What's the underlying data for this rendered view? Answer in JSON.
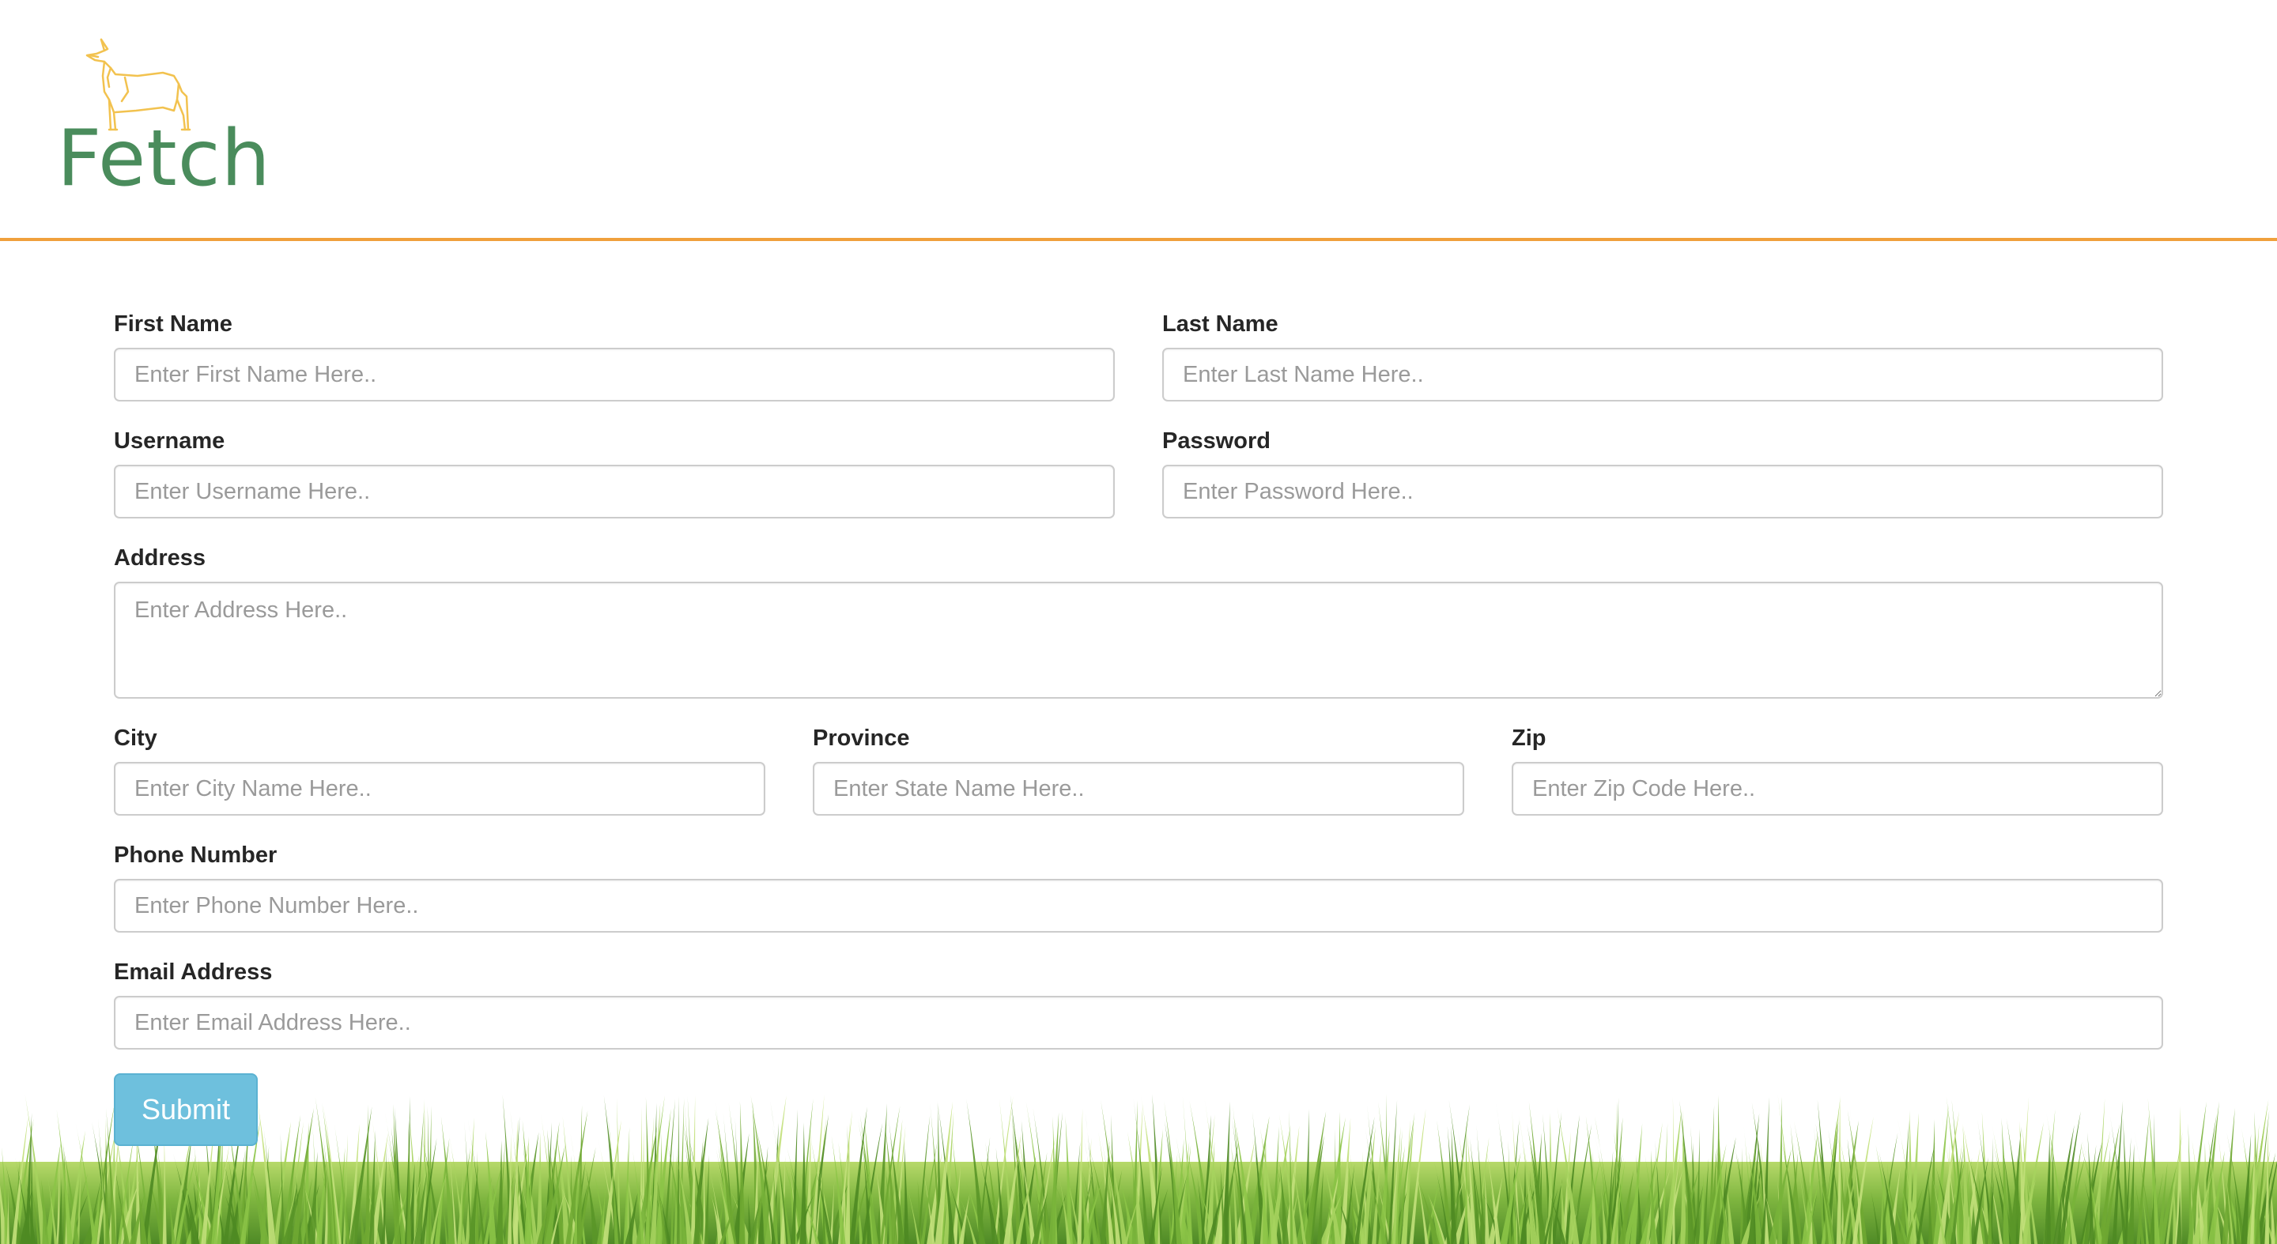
{
  "brand": {
    "name": "Fetch",
    "logo_icon": "dog-icon",
    "logo_color": "#f2c24f",
    "text_color": "#4a8c5c",
    "divider_color": "#f0a03c"
  },
  "form": {
    "first_name": {
      "label": "First Name",
      "placeholder": "Enter First Name Here.."
    },
    "last_name": {
      "label": "Last Name",
      "placeholder": "Enter Last Name Here.."
    },
    "username": {
      "label": "Username",
      "placeholder": "Enter Username Here.."
    },
    "password": {
      "label": "Password",
      "placeholder": "Enter Password Here.."
    },
    "address": {
      "label": "Address",
      "placeholder": "Enter Address Here.."
    },
    "city": {
      "label": "City",
      "placeholder": "Enter City Name Here.."
    },
    "province": {
      "label": "Province",
      "placeholder": "Enter State Name Here.."
    },
    "zip": {
      "label": "Zip",
      "placeholder": "Enter Zip Code Here.."
    },
    "phone": {
      "label": "Phone Number",
      "placeholder": "Enter Phone Number Here.."
    },
    "email": {
      "label": "Email Address",
      "placeholder": "Enter Email Address Here.."
    },
    "submit_label": "Submit",
    "submit_color": "#6ec0dd"
  },
  "footer": {
    "decoration": "grass-image",
    "grass_color": "#7cb342"
  }
}
